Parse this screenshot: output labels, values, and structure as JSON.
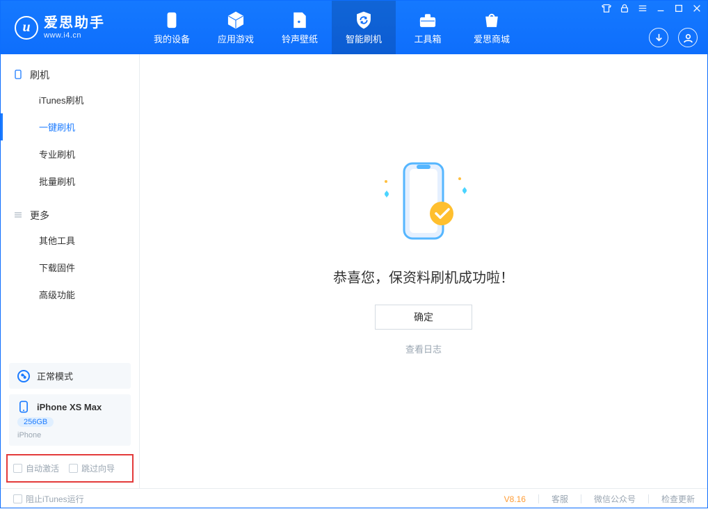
{
  "brand": {
    "title": "爱思助手",
    "subtitle": "www.i4.cn"
  },
  "topnav": [
    {
      "label": "我的设备"
    },
    {
      "label": "应用游戏"
    },
    {
      "label": "铃声壁纸"
    },
    {
      "label": "智能刷机",
      "selected": true
    },
    {
      "label": "工具箱"
    },
    {
      "label": "爱思商城"
    }
  ],
  "sidebar": {
    "groups": [
      {
        "title": "刷机",
        "items": [
          {
            "label": "iTunes刷机"
          },
          {
            "label": "一键刷机",
            "active": true
          },
          {
            "label": "专业刷机"
          },
          {
            "label": "批量刷机"
          }
        ]
      },
      {
        "title": "更多",
        "items": [
          {
            "label": "其他工具"
          },
          {
            "label": "下载固件"
          },
          {
            "label": "高级功能"
          }
        ]
      }
    ],
    "mode_label": "正常模式",
    "device": {
      "name": "iPhone XS Max",
      "capacity": "256GB",
      "type": "iPhone"
    },
    "opts": {
      "auto_activate": "自动激活",
      "skip_guide": "跳过向导"
    }
  },
  "main": {
    "success_title": "恭喜您，保资料刷机成功啦！",
    "ok_label": "确定",
    "view_log": "查看日志"
  },
  "statusbar": {
    "block_itunes": "阻止iTunes运行",
    "version": "V8.16",
    "kefu": "客服",
    "wechat": "微信公众号",
    "update": "检查更新"
  }
}
